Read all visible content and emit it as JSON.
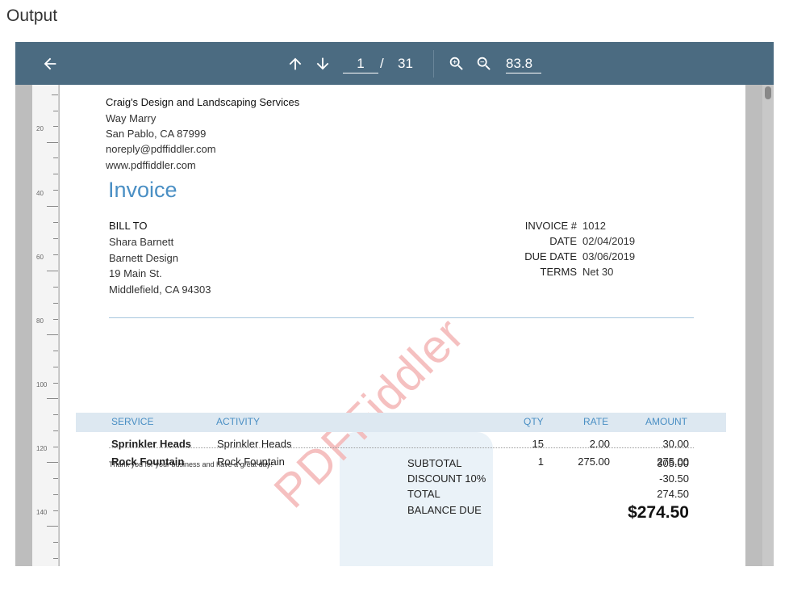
{
  "caption": "Output",
  "toolbar": {
    "page_current": "1",
    "page_separator": "/",
    "page_total": "31",
    "zoom_value": "83.8",
    "icons": [
      "back-arrow-icon",
      "arrow-up-icon",
      "arrow-down-icon",
      "zoom-in-icon",
      "zoom-out-icon"
    ]
  },
  "ruler": {
    "labels": [
      "20",
      "40",
      "60",
      "80",
      "100",
      "120",
      "140"
    ]
  },
  "document": {
    "company": {
      "name": "Craig's Design and Landscaping Services",
      "address1": "Way Marry",
      "address2": "San Pablo, CA  87999",
      "email": "noreply@pdffiddler.com",
      "website": "www.pdffiddler.com"
    },
    "title": "Invoice",
    "bill_to": {
      "heading": "BILL TO",
      "name": "Shara Barnett",
      "company": "Barnett Design",
      "street": "19 Main St.",
      "city": "Middlefield, CA  94303"
    },
    "meta": [
      {
        "label": "INVOICE #",
        "value": "1012"
      },
      {
        "label": "DATE",
        "value": "02/04/2019"
      },
      {
        "label": "DUE DATE",
        "value": "03/06/2019"
      },
      {
        "label": "TERMS",
        "value": "Net 30"
      }
    ],
    "table": {
      "headers": {
        "service": "SERVICE",
        "activity": "ACTIVITY",
        "qty": "QTY",
        "rate": "RATE",
        "amount": "AMOUNT"
      },
      "rows": [
        {
          "service": "Sprinkler Heads",
          "activity": "Sprinkler Heads",
          "qty": "15",
          "rate": "2.00",
          "amount": "30.00"
        },
        {
          "service": "Rock Fountain",
          "activity": "Rock Fountain",
          "qty": "1",
          "rate": "275.00",
          "amount": "275.00"
        }
      ]
    },
    "thanks": "Thank you for your business and have a great day!",
    "summary": {
      "subtotal_label": "SUBTOTAL",
      "subtotal_value": "305.00",
      "discount_label": "DISCOUNT  10%",
      "discount_value": "-30.50",
      "total_label": "TOTAL",
      "total_value": "274.50",
      "balance_label": "BALANCE DUE",
      "balance_value": "$274.50"
    },
    "watermark": "PDFFiddler"
  },
  "colors": {
    "toolbar": "#4b6b81",
    "accent": "#4a8fc4",
    "table_header_bg": "#dde8f1"
  }
}
